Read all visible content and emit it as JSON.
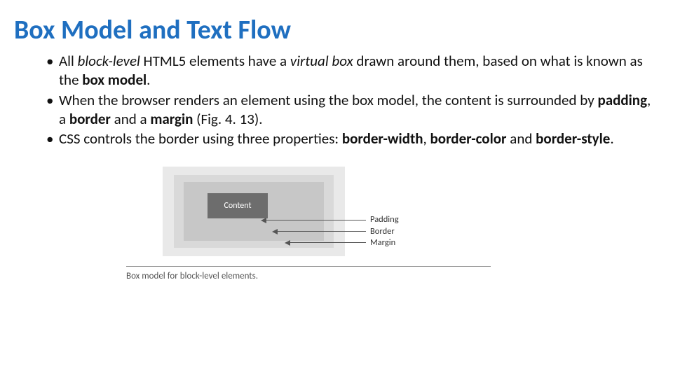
{
  "title": "Box Model and Text Flow",
  "bullets": [
    {
      "segments": [
        {
          "t": "All ",
          "cls": ""
        },
        {
          "t": "block-level",
          "cls": "i"
        },
        {
          "t": " HTML5 elements have a ",
          "cls": ""
        },
        {
          "t": "virtual box",
          "cls": "i"
        },
        {
          "t": " drawn around them, based on what is known as the ",
          "cls": ""
        },
        {
          "t": "box model",
          "cls": "b"
        },
        {
          "t": ".",
          "cls": ""
        }
      ]
    },
    {
      "segments": [
        {
          "t": "When the browser renders an element using the box model, the content is surrounded by ",
          "cls": ""
        },
        {
          "t": "padding",
          "cls": "b"
        },
        {
          "t": ", a ",
          "cls": ""
        },
        {
          "t": "border ",
          "cls": "b"
        },
        {
          "t": "and a ",
          "cls": ""
        },
        {
          "t": "margin ",
          "cls": "b"
        },
        {
          "t": "(Fig. 4. 13).",
          "cls": ""
        }
      ]
    },
    {
      "segments": [
        {
          "t": "CSS controls the border using three properties: ",
          "cls": ""
        },
        {
          "t": "border-width",
          "cls": "b"
        },
        {
          "t": ", ",
          "cls": ""
        },
        {
          "t": "border-color ",
          "cls": "b"
        },
        {
          "t": "and ",
          "cls": ""
        },
        {
          "t": "border-style",
          "cls": "b"
        },
        {
          "t": ".",
          "cls": ""
        }
      ]
    }
  ],
  "figure": {
    "content_label": "Content",
    "labels": {
      "padding": "Padding",
      "border": "Border",
      "margin": "Margin"
    },
    "caption": "Box model for block-level elements."
  }
}
